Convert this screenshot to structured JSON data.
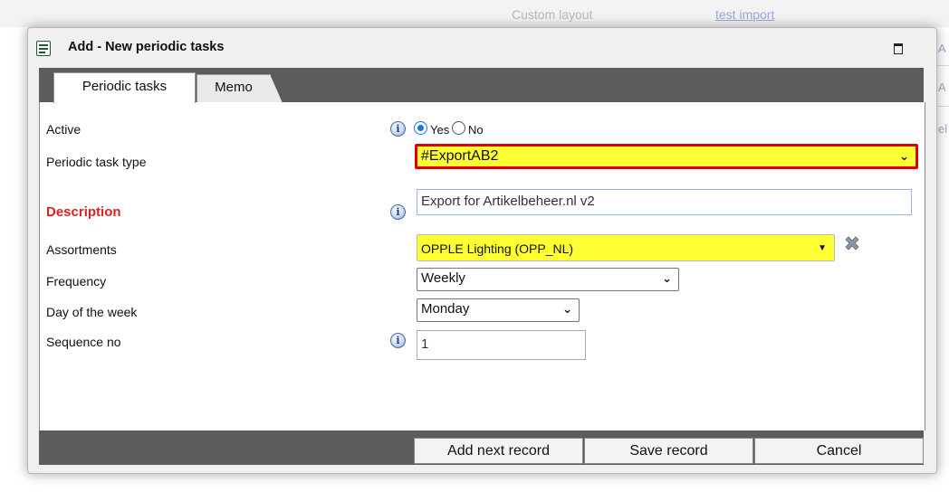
{
  "background": {
    "custom_layout_label": "Custom layout",
    "test_import_link": "test import",
    "edge_links": [
      "A",
      "A",
      "el"
    ]
  },
  "dialog": {
    "title": "Add - New periodic tasks",
    "tabs": [
      {
        "label": "Periodic tasks",
        "active": true
      },
      {
        "label": "Memo",
        "active": false
      }
    ]
  },
  "form": {
    "active": {
      "label": "Active",
      "options": [
        "Yes",
        "No"
      ],
      "selected": "Yes"
    },
    "task_type": {
      "label": "Periodic task type",
      "value": "#ExportAB2"
    },
    "description": {
      "label": "Description",
      "value": "Export for Artikelbeheer.nl v2",
      "required": true
    },
    "assortments": {
      "label": "Assortments",
      "value": "OPPLE Lighting (OPP_NL)"
    },
    "frequency": {
      "label": "Frequency",
      "value": "Weekly"
    },
    "day_of_week": {
      "label": "Day of the week",
      "value": "Monday"
    },
    "sequence": {
      "label": "Sequence no",
      "value": "1"
    }
  },
  "buttons": {
    "add_next": "Add next record",
    "save": "Save record",
    "cancel": "Cancel"
  },
  "colors": {
    "highlight": "#ffff33",
    "error_border": "#e00000",
    "required_label": "#e02020",
    "bar": "#5c5c5c"
  }
}
